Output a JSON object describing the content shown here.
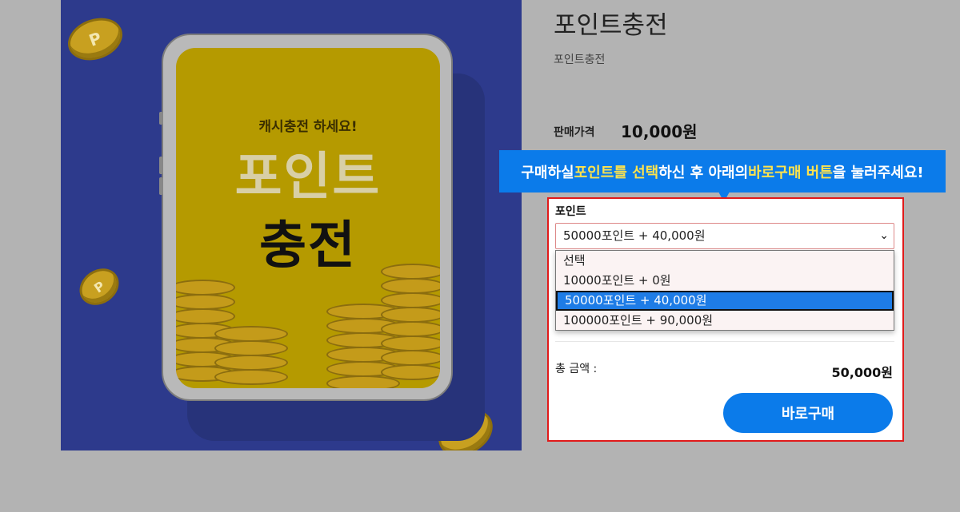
{
  "product": {
    "title": "포인트충전",
    "subtitle": "포인트충전",
    "price_label": "판매가격",
    "price_value": "10,000원"
  },
  "image": {
    "sub_text": "캐시충전 하세요!",
    "line1": "포인트",
    "line2": "충전",
    "coin_glyph": "P",
    "colors": {
      "background": "#2d3a8c",
      "screen": "#b59a00",
      "coin": "#c8a020"
    }
  },
  "tooltip": {
    "part1": "구매하실 ",
    "highlight1": "포인트를 선택",
    "part2": "하신 후 아래의 ",
    "highlight2": "바로구매 버튼",
    "part3": "을 눌러주세요!",
    "colors": {
      "background": "#0b7bea",
      "highlight": "#ffe34d"
    }
  },
  "options": {
    "label": "포인트",
    "selected_value": "50000포인트  + 40,000원",
    "chevron_icon": "chevron-down-icon",
    "list": [
      {
        "label": "선택"
      },
      {
        "label": "10000포인트  + 0원"
      },
      {
        "label": "50000포인트  + 40,000원"
      },
      {
        "label": "100000포인트  + 90,000원"
      }
    ]
  },
  "total": {
    "label": "총 금액 :",
    "value": "50,000원"
  },
  "buy_button": {
    "label": "바로구매",
    "color": "#0b7bea"
  },
  "box_border_color": "#e11a1a"
}
